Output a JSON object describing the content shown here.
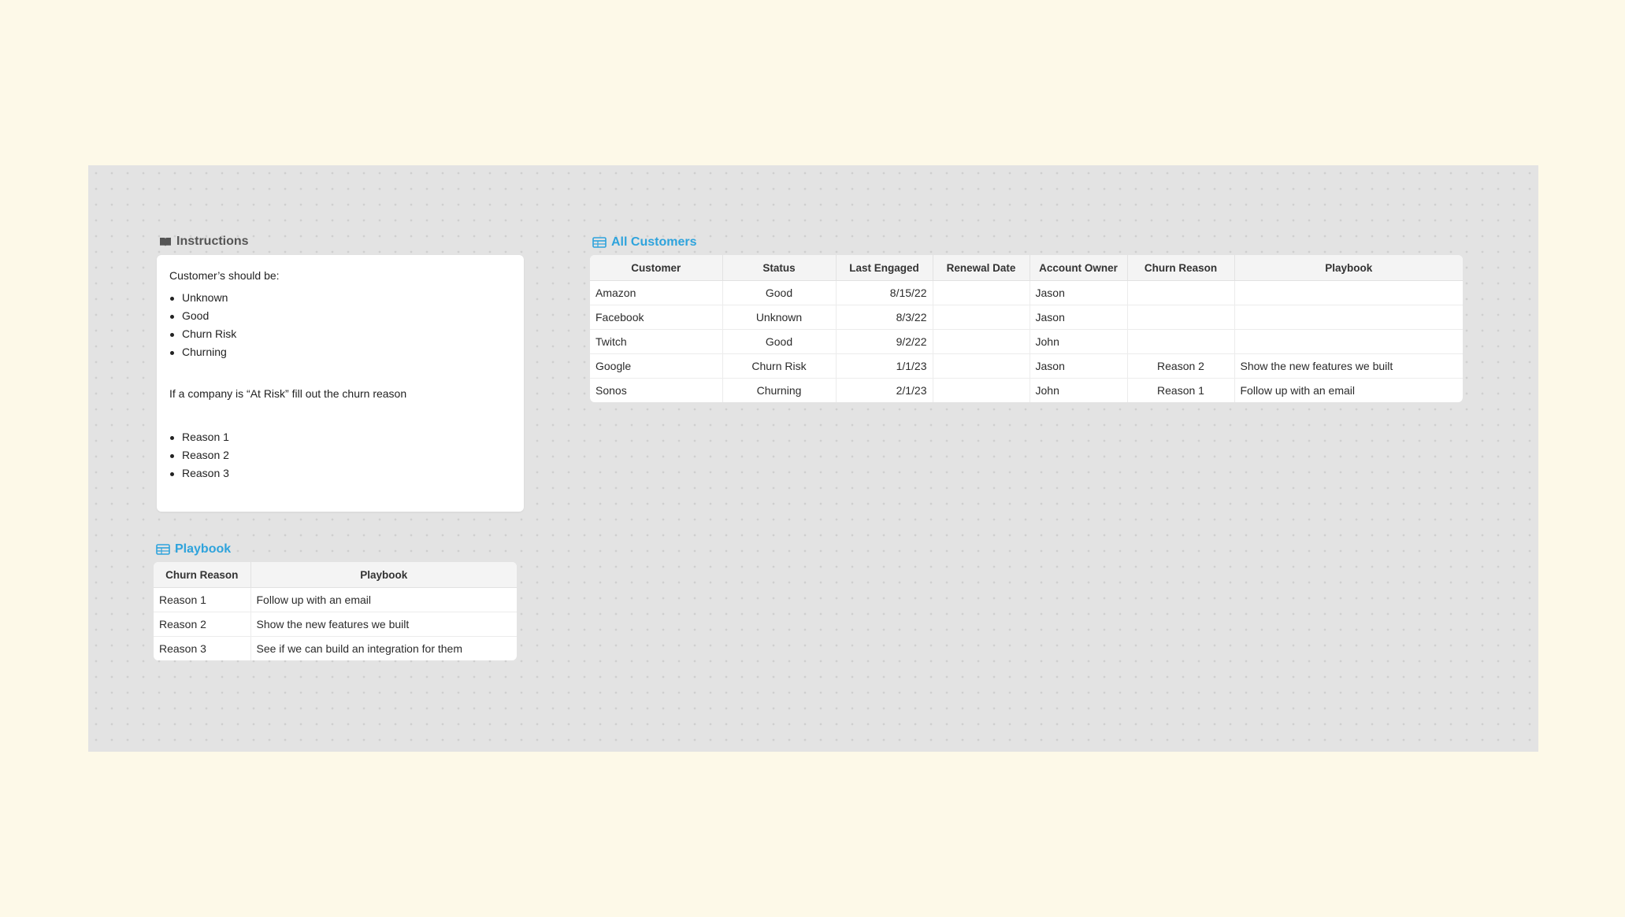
{
  "instructions": {
    "title": "Instructions",
    "intro": "Customer’s should be:",
    "statuses": [
      "Unknown",
      "Good",
      "Churn Risk",
      "Churning"
    ],
    "note": "If a company is “At Risk” fill out the churn reason",
    "reasons": [
      "Reason 1",
      "Reason 2",
      "Reason 3"
    ]
  },
  "customers": {
    "title": "All Customers",
    "columns": [
      "Customer",
      "Status",
      "Last Engaged",
      "Renewal Date",
      "Account Owner",
      "Churn Reason",
      "Playbook"
    ],
    "rows": [
      {
        "customer": "Amazon",
        "status": "Good",
        "last_engaged": "8/15/22",
        "renewal_date": "",
        "owner": "Jason",
        "churn_reason": "",
        "playbook": ""
      },
      {
        "customer": "Facebook",
        "status": "Unknown",
        "last_engaged": "8/3/22",
        "renewal_date": "",
        "owner": "Jason",
        "churn_reason": "",
        "playbook": ""
      },
      {
        "customer": "Twitch",
        "status": "Good",
        "last_engaged": "9/2/22",
        "renewal_date": "",
        "owner": "John",
        "churn_reason": "",
        "playbook": ""
      },
      {
        "customer": "Google",
        "status": "Churn Risk",
        "last_engaged": "1/1/23",
        "renewal_date": "",
        "owner": "Jason",
        "churn_reason": "Reason 2",
        "playbook": "Show the new features we built"
      },
      {
        "customer": "Sonos",
        "status": "Churning",
        "last_engaged": "2/1/23",
        "renewal_date": "",
        "owner": "John",
        "churn_reason": "Reason 1",
        "playbook": "Follow up with an email"
      }
    ]
  },
  "playbook": {
    "title": "Playbook",
    "columns": [
      "Churn Reason",
      "Playbook"
    ],
    "rows": [
      {
        "reason": "Reason 1",
        "playbook": "Follow up with an email"
      },
      {
        "reason": "Reason 2",
        "playbook": "Show the new features we built"
      },
      {
        "reason": "Reason 3",
        "playbook": "See if we can build an integration for them"
      }
    ]
  },
  "colors": {
    "background": "#fdf9e8",
    "canvas": "#e3e3e3",
    "accent": "#2ea3dc"
  },
  "icons": {
    "instructions": "book-icon",
    "customers": "table-icon",
    "playbook": "table-icon"
  }
}
